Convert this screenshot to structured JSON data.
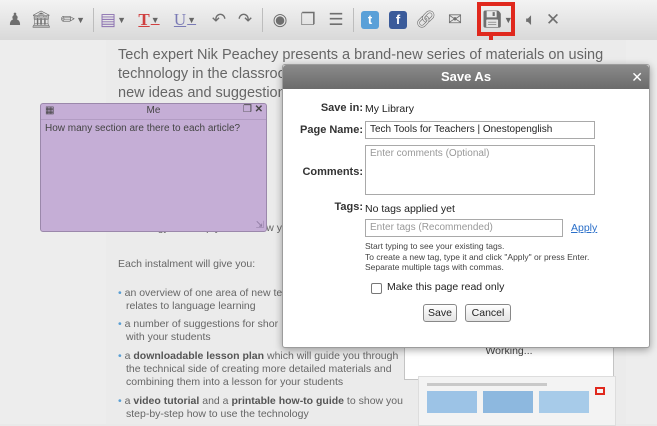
{
  "toolbar": {
    "highlight_color": "#e0281d",
    "icons": [
      "person-icon",
      "bank-icon",
      "highlighter-icon",
      "note-icon",
      "text-icon",
      "underline-icon",
      "undo-icon",
      "redo-icon",
      "eye-icon",
      "windows-icon",
      "list-icon",
      "twitter-icon",
      "facebook-icon",
      "link-icon",
      "mail-icon",
      "save-icon",
      "speaker-icon",
      "close-icon"
    ]
  },
  "article": {
    "intro": "Tech expert Nik Peachey presents a brand-new series of materials on using technology in the classroom. If you're al",
    "intro_line3": "new ideas and suggestions;",
    "partial_line_1": "technology and help you see how y",
    "instalment": "Each instalment will give you:",
    "bullet_1a": "an overview of one area of new te",
    "bullet_1b": "relates to language learning",
    "bullet_2a": "a number of suggestions for shor",
    "bullet_2b": "with your students",
    "bullet_3_pre": "a ",
    "bullet_3_bold": "downloadable lesson plan",
    "bullet_3_post": " which will guide you through",
    "bullet_3b": "the technical side of creating more detailed materials and",
    "bullet_3c": "combining them into a lesson for your students",
    "bullet_4_pre": "a ",
    "bullet_4_bold1": "video tutorial",
    "bullet_4_mid": " and a ",
    "bullet_4_bold2": "printable how-to guide",
    "bullet_4_post": " to show you",
    "bullet_4b": "step-by-step how to use the technology"
  },
  "note": {
    "title": "Me",
    "text": "How many section are there to each article?",
    "color": "#c5aed6"
  },
  "dialog": {
    "title": "Save As",
    "save_in_label": "Save in:",
    "save_in_value": "My Library",
    "page_name_label": "Page Name:",
    "page_name_value": "Tech Tools for Teachers | Onestopenglish",
    "comments_label": "Comments:",
    "comments_placeholder": "Enter comments (Optional)",
    "tags_label": "Tags:",
    "tags_status": "No tags applied yet",
    "tags_placeholder": "Enter tags (Recommended)",
    "apply_label": "Apply",
    "help_1": "Start typing to see your existing tags.",
    "help_2": "To create a new tag, type it and click \"Apply\" or press Enter.",
    "help_3": "Separate multiple tags with commas.",
    "readonly_label": "Make this page read only",
    "save_label": "Save",
    "cancel_label": "Cancel"
  },
  "working": {
    "text": "Working..."
  }
}
